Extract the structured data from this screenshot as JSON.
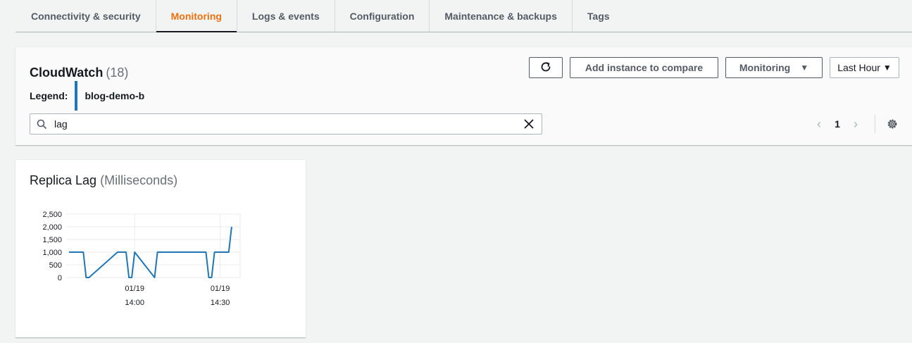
{
  "tabs": [
    {
      "label": "Connectivity & security"
    },
    {
      "label": "Monitoring"
    },
    {
      "label": "Logs & events"
    },
    {
      "label": "Configuration"
    },
    {
      "label": "Maintenance & backups"
    },
    {
      "label": "Tags"
    }
  ],
  "active_tab": "Monitoring",
  "cloudwatch": {
    "title": "CloudWatch",
    "count": "(18)",
    "legend_label": "Legend:",
    "legend_item": "blog-demo-b",
    "legend_color": "#1f77b4",
    "refresh_icon": "refresh-icon",
    "add_compare_label": "Add instance to compare",
    "monitoring_label": "Monitoring",
    "time_range_label": "Last Hour",
    "search_value": "lag",
    "search_icon": "search-icon",
    "clear_icon": "close-icon",
    "page_number": "1",
    "settings_icon": "gear-icon"
  },
  "card": {
    "title": "Replica Lag",
    "unit": "(Milliseconds)"
  },
  "chart_data": {
    "type": "line",
    "title": "Replica Lag (Milliseconds)",
    "xlabel": "",
    "ylabel": "",
    "ylim": [
      0,
      2500
    ],
    "yticks": [
      "2,500",
      "2,000",
      "1,500",
      "1,000",
      "500",
      "0"
    ],
    "xticks": [
      {
        "date": "01/19",
        "time": "14:00"
      },
      {
        "date": "01/19",
        "time": "14:30"
      }
    ],
    "grid": true,
    "series": [
      {
        "name": "blog-demo-b",
        "color": "#1f77b4",
        "x": [
          "13:37",
          "13:41",
          "13:42",
          "13:43",
          "13:44",
          "13:54",
          "13:56",
          "13:57",
          "13:58",
          "13:59",
          "14:00",
          "14:07",
          "14:08",
          "14:09",
          "14:14",
          "14:16",
          "14:17",
          "14:18",
          "14:25",
          "14:26",
          "14:27",
          "14:28",
          "14:29",
          "14:33",
          "14:34"
        ],
        "values": [
          1000,
          1000,
          1000,
          0,
          0,
          1000,
          1000,
          1000,
          0,
          0,
          1000,
          0,
          1000,
          1000,
          1000,
          1000,
          1000,
          1000,
          1000,
          0,
          0,
          1000,
          1000,
          1000,
          2000
        ]
      }
    ]
  }
}
